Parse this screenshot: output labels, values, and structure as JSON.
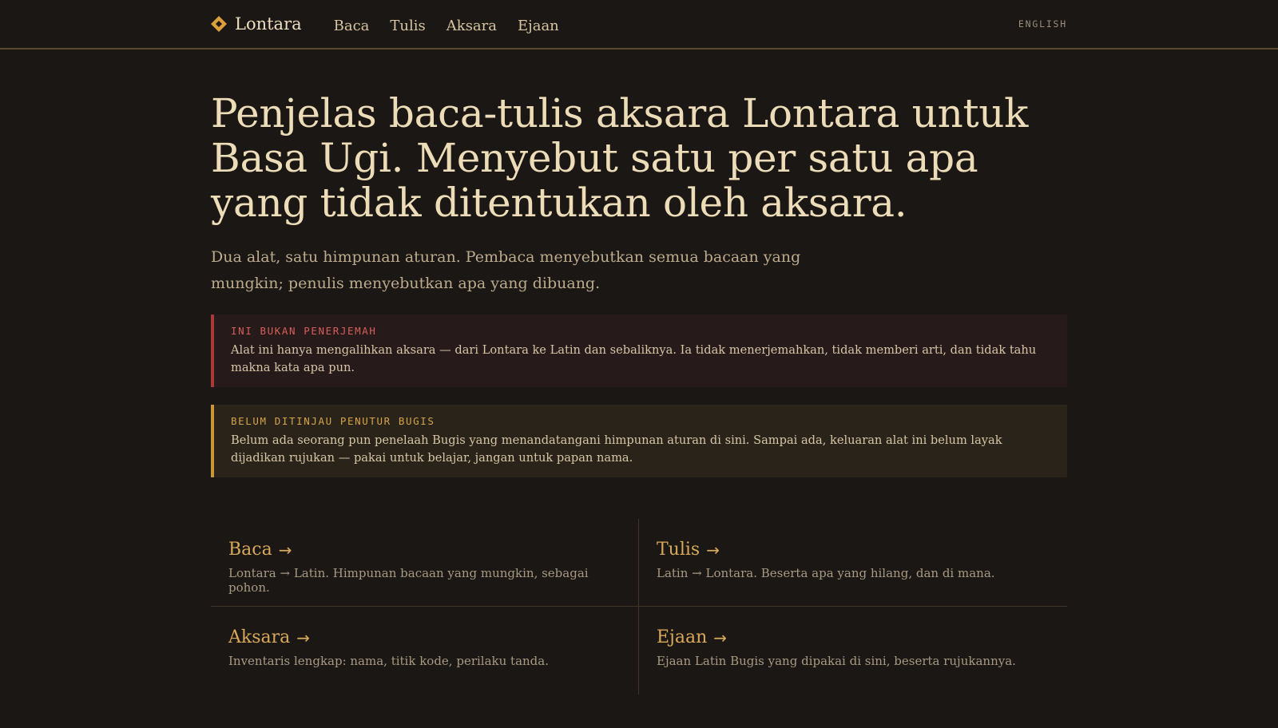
{
  "colors": {
    "background": "#1b1714",
    "accent": "#d9a95a",
    "danger": "#a83a3a",
    "warning": "#c9973a"
  },
  "brand": {
    "icon": "diamond-icon",
    "name": "Lontara"
  },
  "nav": {
    "items": [
      {
        "label": "Baca"
      },
      {
        "label": "Tulis"
      },
      {
        "label": "Aksara"
      },
      {
        "label": "Ejaan"
      }
    ],
    "language_label": "ENGLISH"
  },
  "hero": {
    "title": "Penjelas baca-tulis aksara Lontara untuk Basa Ugi. Menyebut satu per satu apa yang tidak ditentukan oleh aksara.",
    "lede": "Dua alat, satu himpunan aturan. Pembaca menyebutkan semua bacaan yang mungkin; penulis menyebutkan apa yang dibuang."
  },
  "notices": [
    {
      "label": "INI BUKAN PENERJEMAH",
      "text": "Alat ini hanya mengalihkan aksara — dari Lontara ke Latin dan sebaliknya. Ia tidak menerjemahkan, tidak memberi arti, dan tidak tahu makna kata apa pun."
    },
    {
      "label": "BELUM DITINJAU PENUTUR BUGIS",
      "text": "Belum ada seorang pun penelaah Bugis yang menandatangani himpunan aturan di sini. Sampai ada, keluaran alat ini belum layak dijadikan rujukan — pakai untuk belajar, jangan untuk papan nama."
    }
  ],
  "cards": [
    {
      "title": "Baca",
      "arrow": "→",
      "description": "Lontara → Latin. Himpunan bacaan yang mungkin, sebagai pohon."
    },
    {
      "title": "Tulis",
      "arrow": "→",
      "description": "Latin → Lontara. Beserta apa yang hilang, dan di mana."
    },
    {
      "title": "Aksara",
      "arrow": "→",
      "description": "Inventaris lengkap: nama, titik kode, perilaku tanda."
    },
    {
      "title": "Ejaan",
      "arrow": "→",
      "description": "Ejaan Latin Bugis yang dipakai di sini, beserta rujukannya."
    }
  ]
}
